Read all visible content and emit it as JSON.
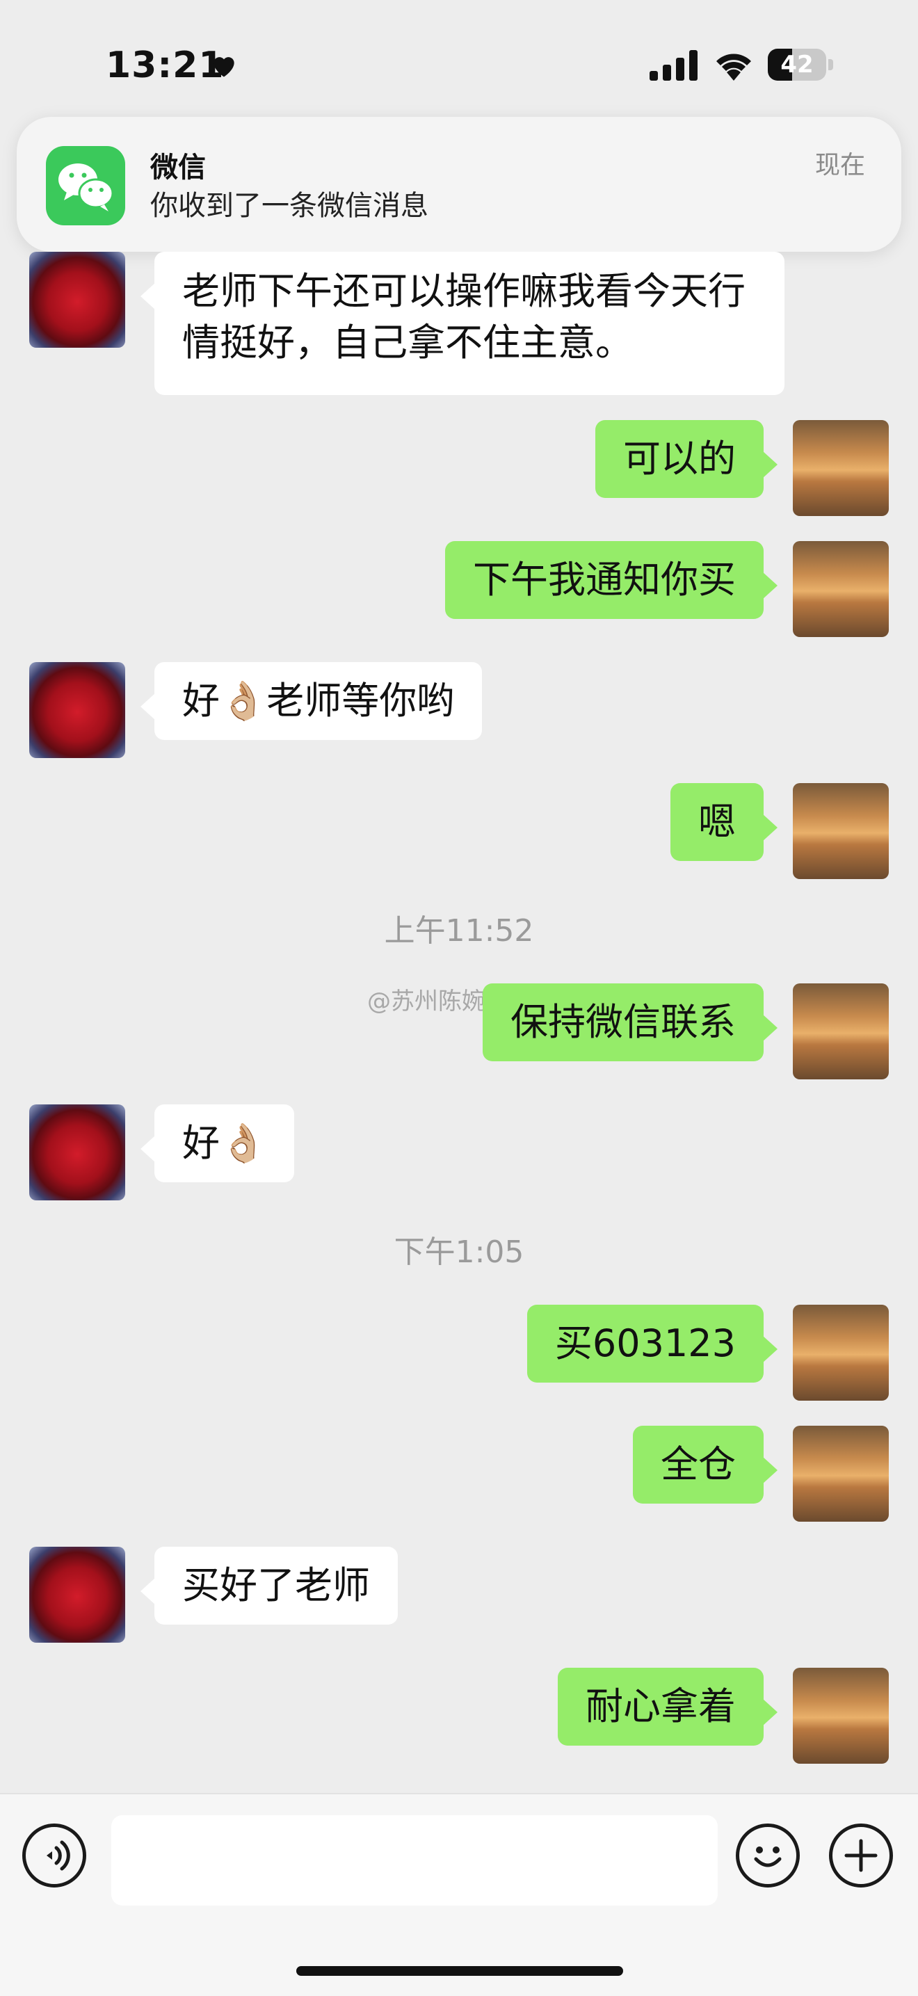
{
  "status_bar": {
    "time": "13:21",
    "battery_level": "42",
    "battery_fraction": 0.42
  },
  "notification": {
    "app_name": "微信",
    "message": "你收到了一条微信消息",
    "time": "现在"
  },
  "watermark": "@苏州陈婉婉",
  "messages": [
    {
      "side": "in",
      "text": "老师下午还可以操作嘛我看今天行情挺好，自己拿不住主意。"
    },
    {
      "side": "out",
      "text": "可以的"
    },
    {
      "side": "out",
      "text": "下午我通知你买"
    },
    {
      "side": "in",
      "text": "好👌🏼老师等你哟"
    },
    {
      "side": "out",
      "text": "嗯"
    },
    {
      "side": "time",
      "text": "上午11:52"
    },
    {
      "side": "out",
      "text": "保持微信联系"
    },
    {
      "side": "in",
      "text": "好👌🏼"
    },
    {
      "side": "time",
      "text": "下午1:05"
    },
    {
      "side": "out",
      "text": "买603123"
    },
    {
      "side": "out",
      "text": "全仓"
    },
    {
      "side": "in",
      "text": "买好了老师"
    },
    {
      "side": "out",
      "text": "耐心拿着"
    }
  ],
  "icons": {
    "voice": "voice-icon",
    "emoji": "emoji-icon",
    "plus": "plus-icon",
    "heart": "heart-icon",
    "signal": "signal-icon",
    "wifi": "wifi-icon",
    "battery": "battery-icon",
    "wechat": "wechat-icon"
  },
  "colors": {
    "outgoing_bubble": "#95ec69",
    "incoming_bubble": "#ffffff",
    "background": "#ededed",
    "wechat_green": "#3bc95b"
  }
}
